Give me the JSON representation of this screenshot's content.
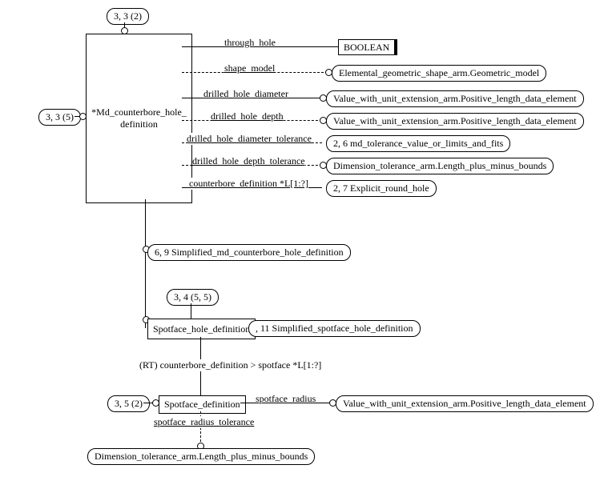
{
  "refs": {
    "top": "3, 3 (2)",
    "left": "3, 3 (5)",
    "spotfaceHole": "3, 4 (5, 5)",
    "spotfaceDef": "3, 5 (2)"
  },
  "entities": {
    "main": "*Md_counterbore_hole_\ndefinition",
    "spotfaceHole": "Spotface_hole_definition",
    "spotfaceDef": "Spotface_definition"
  },
  "attrs": {
    "through_hole": "through_hole",
    "shape_model": "shape_model",
    "drilled_hole_diameter": "drilled_hole_diameter",
    "drilled_hole_depth": "drilled_hole_depth",
    "drilled_hole_diameter_tolerance": "drilled_hole_diameter_tolerance",
    "drilled_hole_depth_tolerance": "drilled_hole_depth_tolerance",
    "counterbore_definition": "counterbore_definition *L[1:?]",
    "rt_counterbore": "(RT) counterbore_definition > spotface *L[1:?]",
    "spotface_radius": "spotface_radius",
    "spotface_radius_tolerance": "spotface_radius_tolerance"
  },
  "targets": {
    "boolean": "BOOLEAN",
    "geometric_model": "Elemental_geometric_shape_arm.Geometric_model",
    "positive_length": "Value_with_unit_extension_arm.Positive_length_data_element",
    "tolerance_value": "2, 6 md_tolerance_value_or_limits_and_fits",
    "length_bounds": "Dimension_tolerance_arm.Length_plus_minus_bounds",
    "explicit_round_hole": "2, 7 Explicit_round_hole",
    "simplified_cb": "6, 9 Simplified_md_counterbore_hole_definition",
    "simplified_sf": ", 11 Simplified_spotface_hole_definition"
  }
}
